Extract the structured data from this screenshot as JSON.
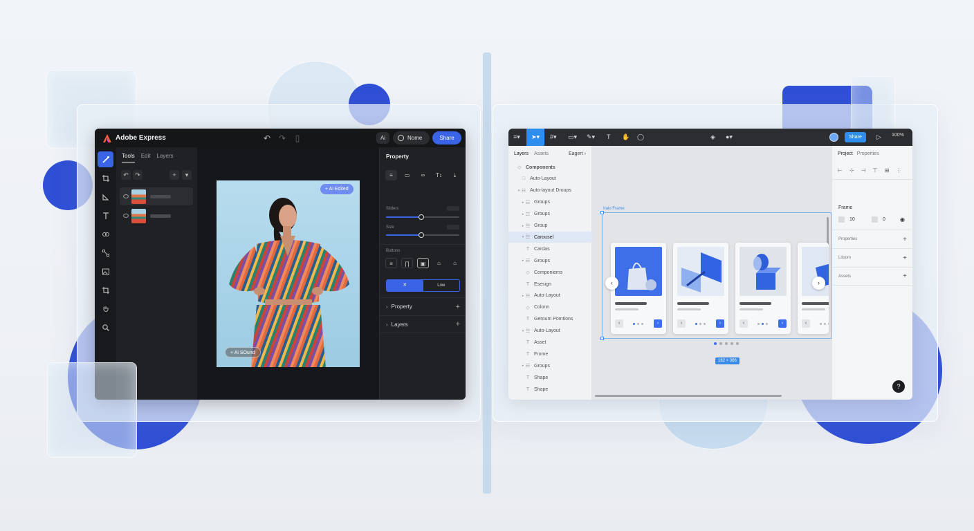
{
  "left_app": {
    "title": "Adobe Express",
    "ai_label": "Ai",
    "home_label": "Nome",
    "share_label": "Share",
    "tabs": [
      "Tools",
      "Edit",
      "Layers"
    ],
    "canvas": {
      "chip_top": "+ Ai Edited",
      "chip_bottom": "+ Ai SOund"
    },
    "props": {
      "title": "Property",
      "sliders_label": "Sliders",
      "slider2_label": "Size",
      "slider_values": [
        0.48,
        0.48
      ],
      "buttons_label": "Buttons",
      "toggle_left": "✕",
      "toggle_right": "Low",
      "accordion": [
        "Property",
        "Layers"
      ]
    }
  },
  "right_app": {
    "share_label": "Share",
    "zoom": "100%",
    "layers_tabs": [
      "Layers",
      "Assets"
    ],
    "export_label": "Eagert",
    "layers": [
      {
        "label": "Components",
        "glyph": "◇",
        "caret": "",
        "indent": 0
      },
      {
        "label": "Auto-Layout",
        "glyph": "□",
        "caret": "",
        "indent": 1
      },
      {
        "label": "Auto-layout Droups",
        "glyph": "☷",
        "caret": "▾",
        "indent": 1
      },
      {
        "label": "Groups",
        "glyph": "☷",
        "caret": "▸",
        "indent": 2
      },
      {
        "label": "Groups",
        "glyph": "☷",
        "caret": "▸",
        "indent": 2
      },
      {
        "label": "Group",
        "glyph": "☷",
        "caret": "▸",
        "indent": 2
      },
      {
        "label": "Carousel",
        "glyph": "☷",
        "caret": "▾",
        "indent": 2,
        "selected": true
      },
      {
        "label": "Cardas",
        "glyph": "T",
        "caret": "",
        "indent": 2
      },
      {
        "label": "Groups",
        "glyph": "☷",
        "caret": "▸",
        "indent": 2
      },
      {
        "label": "Componiems",
        "glyph": "◇",
        "caret": "",
        "indent": 2
      },
      {
        "label": "Esesign",
        "glyph": "T",
        "caret": "",
        "indent": 2
      },
      {
        "label": "Auto-Layout",
        "glyph": "☷",
        "caret": "▸",
        "indent": 2
      },
      {
        "label": "Colonn",
        "glyph": "◇",
        "caret": "",
        "indent": 2
      },
      {
        "label": "Geroum Pomtions",
        "glyph": "T",
        "caret": "",
        "indent": 2
      },
      {
        "label": "Auto-Layout",
        "glyph": "☷",
        "caret": "▾",
        "indent": 2
      },
      {
        "label": "Asset",
        "glyph": "T",
        "caret": "",
        "indent": 2
      },
      {
        "label": "Frome",
        "glyph": "T",
        "caret": "",
        "indent": 2
      },
      {
        "label": "Groups",
        "glyph": "☷",
        "caret": "▸",
        "indent": 2
      },
      {
        "label": "Shape",
        "glyph": "T",
        "caret": "",
        "indent": 2
      },
      {
        "label": "Shape",
        "glyph": "T",
        "caret": "",
        "indent": 2
      }
    ],
    "canvas": {
      "frame_label": "Iralo Frame",
      "size_tag": "162 × 366",
      "active_page": 1,
      "page_count": 5
    },
    "props": {
      "tabs": [
        "Project",
        "Properties"
      ],
      "frame_label": "Frame",
      "frame_w": "10",
      "frame_h": "0",
      "sections": [
        "Properties",
        "Litoom",
        "Assets"
      ],
      "help": "?"
    }
  },
  "colors": {
    "accent_blue": "#3b63e6",
    "figma_blue": "#2d8ef0",
    "dark_bg": "#1d1e21"
  }
}
